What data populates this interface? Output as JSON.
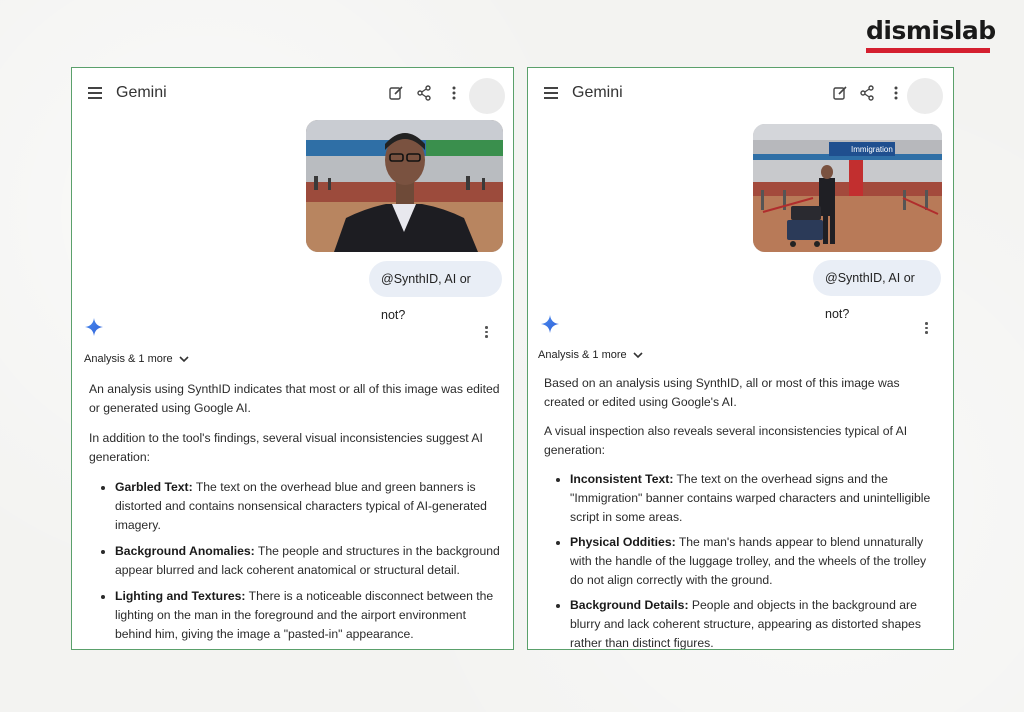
{
  "brand": {
    "name": "dismislab",
    "accent": "#d41f2f"
  },
  "panels": [
    {
      "app_title": "Gemini",
      "prompt": "@SynthID, AI or not?",
      "analysis_label": "Analysis & 1 more",
      "paragraphs": [
        "An analysis using SynthID indicates that most or all of this image was edited or generated using Google AI.",
        "In addition to the tool's findings, several visual inconsistencies suggest AI generation:"
      ],
      "bullets": [
        {
          "title": "Garbled Text:",
          "text": " The text on the overhead blue and green banners is distorted and contains nonsensical characters typical of AI-generated imagery."
        },
        {
          "title": "Background Anomalies:",
          "text": " The people and structures in the background appear blurred and lack coherent anatomical or structural detail."
        },
        {
          "title": "Lighting and Textures:",
          "text": " There is a noticeable disconnect between the lighting on the man in the foreground and the airport environment behind him, giving the image a \"pasted-in\" appearance."
        }
      ]
    },
    {
      "app_title": "Gemini",
      "prompt": "@SynthID, AI or not?",
      "analysis_label": "Analysis & 1 more",
      "sign_text": "Immigration",
      "paragraphs": [
        "Based on an analysis using SynthID, all or most of this image was created or edited using Google's AI.",
        "A visual inspection also reveals several inconsistencies typical of AI generation:"
      ],
      "bullets": [
        {
          "title": "Inconsistent Text:",
          "text": " The text on the overhead signs and the \"Immigration\" banner contains warped characters and unintelligible script in some areas."
        },
        {
          "title": "Physical Oddities:",
          "text": " The man's hands appear to blend unnaturally with the handle of the luggage trolley, and the wheels of the trolley do not align correctly with the ground."
        },
        {
          "title": "Background Details:",
          "text": " People and objects in the background are blurry and lack coherent structure, appearing as distorted shapes rather than distinct figures."
        }
      ]
    }
  ],
  "icons": [
    "menu-icon",
    "edit-icon",
    "share-icon",
    "more-vert-icon",
    "gemini-spark-icon",
    "chevron-down-icon"
  ],
  "colors": {
    "panel_border": "#5aa06b",
    "bubble_bg": "#e9eef6"
  }
}
